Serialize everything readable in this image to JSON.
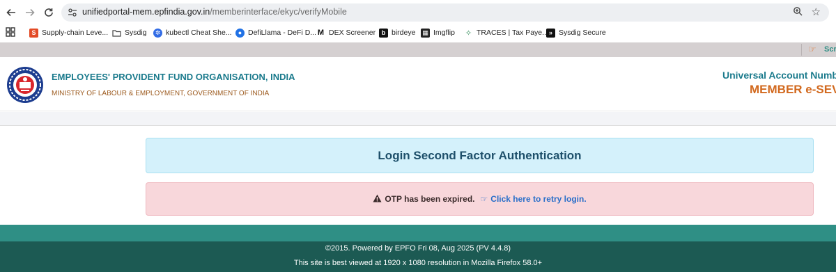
{
  "browser": {
    "url_host": "unifiedportal-mem.epfindia.gov.in",
    "url_path": "/memberinterface/ekyc/verifyMobile",
    "bookmarks": [
      {
        "label": "Supply-chain Leve...",
        "icon": "supply-chain-icon",
        "color": "#e34b26"
      },
      {
        "label": "Sysdig",
        "icon": "folder-icon",
        "color": "#ffffff"
      },
      {
        "label": "kubectl Cheat She...",
        "icon": "kubernetes-icon",
        "color": "#326ce5"
      },
      {
        "label": "DefiLlama - DeFi D...",
        "icon": "defillama-icon",
        "color": "#2172e5"
      },
      {
        "label": "DEX Screener",
        "icon": "dexscreener-icon",
        "color": "#111111"
      },
      {
        "label": "birdeye",
        "icon": "birdeye-icon",
        "color": "#111111"
      },
      {
        "label": "Imgflip",
        "icon": "imgflip-icon",
        "color": "#222222"
      },
      {
        "label": "TRACES | Tax Paye...",
        "icon": "traces-icon",
        "color": "#2e8b57"
      },
      {
        "label": "Sysdig Secure",
        "icon": "sysdig-icon",
        "color": "#111111"
      }
    ]
  },
  "topbar": {
    "scroll_text": "Scr"
  },
  "header": {
    "org_name": "EMPLOYEES' PROVIDENT FUND ORGANISATION, INDIA",
    "org_sub": "MINISTRY OF LABOUR & EMPLOYMENT, GOVERNMENT OF INDIA",
    "uan_title": "Universal Account Numb",
    "member_title": "MEMBER e-SEV"
  },
  "main": {
    "heading": "Login Second Factor Authentication",
    "alert_message": "OTP has been expired.",
    "retry_link": "Click here to retry login."
  },
  "footer": {
    "line1": "©2015. Powered by EPFO Fri 08, Aug 2025 (PV 4.4.8)",
    "line2": "This site is best viewed at 1920 x 1080 resolution in Mozilla Firefox 58.0+"
  },
  "colors": {
    "teal": "#2f8f85",
    "dark_teal": "#1c5a53",
    "info_bg": "#d4f1fb",
    "alert_bg": "#f8d7db",
    "link": "#2a6fc9",
    "accent_orange": "#d2691e"
  }
}
